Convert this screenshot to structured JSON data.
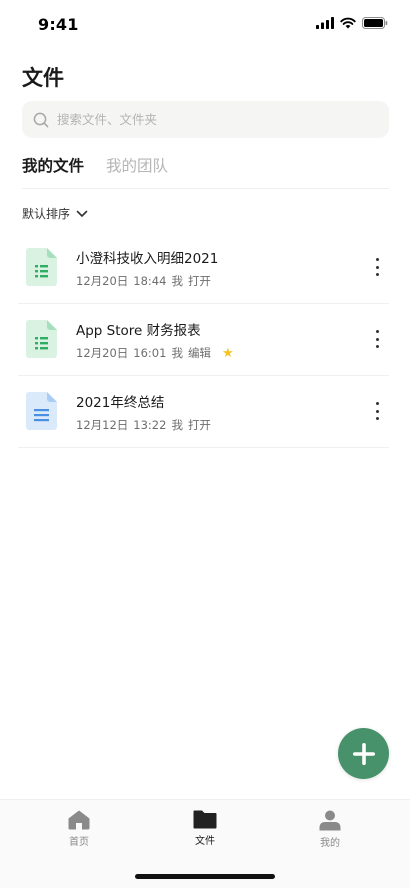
{
  "status_bar": {
    "time": "9:41"
  },
  "page_title": "文件",
  "search": {
    "placeholder": "搜索文件、文件夹"
  },
  "tabs": [
    {
      "label": "我的文件",
      "active": true
    },
    {
      "label": "我的团队",
      "active": false
    }
  ],
  "sort": {
    "label": "默认排序"
  },
  "files": [
    {
      "name": "小澄科技收入明细2021",
      "date": "12月20日",
      "time": "18:44",
      "owner": "我",
      "action": "打开",
      "type": "sheet",
      "starred": false
    },
    {
      "name": "App Store 财务报表",
      "date": "12月20日",
      "time": "16:01",
      "owner": "我",
      "action": "编辑",
      "type": "sheet",
      "starred": true
    },
    {
      "name": "2021年终总结",
      "date": "12月12日",
      "time": "13:22",
      "owner": "我",
      "action": "打开",
      "type": "doc",
      "starred": false
    }
  ],
  "bottom_nav": [
    {
      "label": "首页",
      "icon": "home-icon",
      "active": false
    },
    {
      "label": "文件",
      "icon": "folder-icon",
      "active": true
    },
    {
      "label": "我的",
      "icon": "person-icon",
      "active": false
    }
  ],
  "colors": {
    "accent": "#47926b",
    "sheet_icon": "#d9f2e2",
    "doc_icon": "#dbeafb",
    "star": "#f6c21c"
  }
}
